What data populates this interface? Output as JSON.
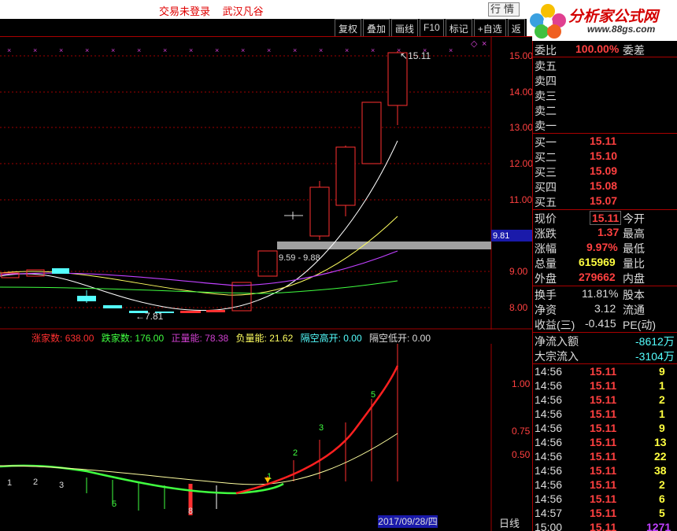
{
  "topbar": {
    "status": "交易未登录",
    "account": "武汉凡谷",
    "quote_button": "行情"
  },
  "logo": {
    "brand": "分析家公式网",
    "url": "www.88gs.com"
  },
  "toolbar": {
    "items": [
      "复权",
      "叠加",
      "画线",
      "F10",
      "标记",
      "+自选",
      "返"
    ]
  },
  "price_axis": {
    "labels": [
      "15.00",
      "14.00",
      "13.00",
      "12.00",
      "11.00",
      "9.00",
      "8.00"
    ],
    "current_tag": "9.81",
    "high_label": "15.11",
    "low_label": "7.81",
    "range_label": "9.59 - 9.88"
  },
  "indicator": {
    "zhang_label": "涨家数:",
    "zhang_value": "638.00",
    "die_label": "跌家数:",
    "die_value": "176.00",
    "pos_label": "正量能:",
    "pos_value": "78.38",
    "neg_label": "负量能:",
    "neg_value": "21.62",
    "gapup_label": "隔空高开:",
    "gapup_value": "0.00",
    "gapdown_label": "隔空低开:",
    "gapdown_value": "0.00",
    "axis": [
      "1.00",
      "0.75",
      "0.50"
    ],
    "markers": [
      "1",
      "2",
      "3",
      "5",
      "8",
      "1",
      "2",
      "3",
      "5"
    ]
  },
  "date_label": "2017/09/28/四",
  "period": "日线",
  "quote": {
    "weibi_label": "委比",
    "weibi_value": "100.00%",
    "weicha_label": "委差",
    "sell_labels": [
      "卖五",
      "卖四",
      "卖三",
      "卖二",
      "卖一"
    ],
    "buy": [
      {
        "label": "买一",
        "price": "15.11"
      },
      {
        "label": "买二",
        "price": "15.10"
      },
      {
        "label": "买三",
        "price": "15.09"
      },
      {
        "label": "买四",
        "price": "15.08"
      },
      {
        "label": "买五",
        "price": "15.07"
      }
    ],
    "stats": [
      {
        "l1": "现价",
        "v1": "15.11",
        "l2": "今开"
      },
      {
        "l1": "涨跌",
        "v1": "1.37",
        "l2": "最高"
      },
      {
        "l1": "涨幅",
        "v1": "9.97%",
        "l2": "最低"
      },
      {
        "l1": "总量",
        "v1": "615969",
        "l2": "量比"
      },
      {
        "l1": "外盘",
        "v1": "279662",
        "l2": "内盘"
      },
      {
        "l1": "换手",
        "v1": "11.81%",
        "l2": "股本"
      },
      {
        "l1": "净资",
        "v1": "3.12",
        "l2": "流通"
      },
      {
        "l1": "收益(三)",
        "v1": "-0.415",
        "l2": "PE(动)"
      }
    ],
    "flows": [
      {
        "label": "净流入额",
        "value": "-8612万"
      },
      {
        "label": "大宗流入",
        "value": "-3104万"
      }
    ],
    "ticks": [
      {
        "t": "14:56",
        "p": "15.11",
        "v": "9"
      },
      {
        "t": "14:56",
        "p": "15.11",
        "v": "1"
      },
      {
        "t": "14:56",
        "p": "15.11",
        "v": "2"
      },
      {
        "t": "14:56",
        "p": "15.11",
        "v": "1"
      },
      {
        "t": "14:56",
        "p": "15.11",
        "v": "9"
      },
      {
        "t": "14:56",
        "p": "15.11",
        "v": "13"
      },
      {
        "t": "14:56",
        "p": "15.11",
        "v": "22"
      },
      {
        "t": "14:56",
        "p": "15.11",
        "v": "38"
      },
      {
        "t": "14:56",
        "p": "15.11",
        "v": "2"
      },
      {
        "t": "14:56",
        "p": "15.11",
        "v": "6"
      },
      {
        "t": "14:57",
        "p": "15.11",
        "v": "5"
      },
      {
        "t": "15:00",
        "p": "15.11",
        "v": "1271"
      }
    ]
  },
  "colors": {
    "up": "#ff3030",
    "down": "#54ffff",
    "accent": "#ff4040",
    "ma_magenta": "#c040ff",
    "ma_yellow": "#ffff60",
    "ma_green": "#40ff40"
  }
}
